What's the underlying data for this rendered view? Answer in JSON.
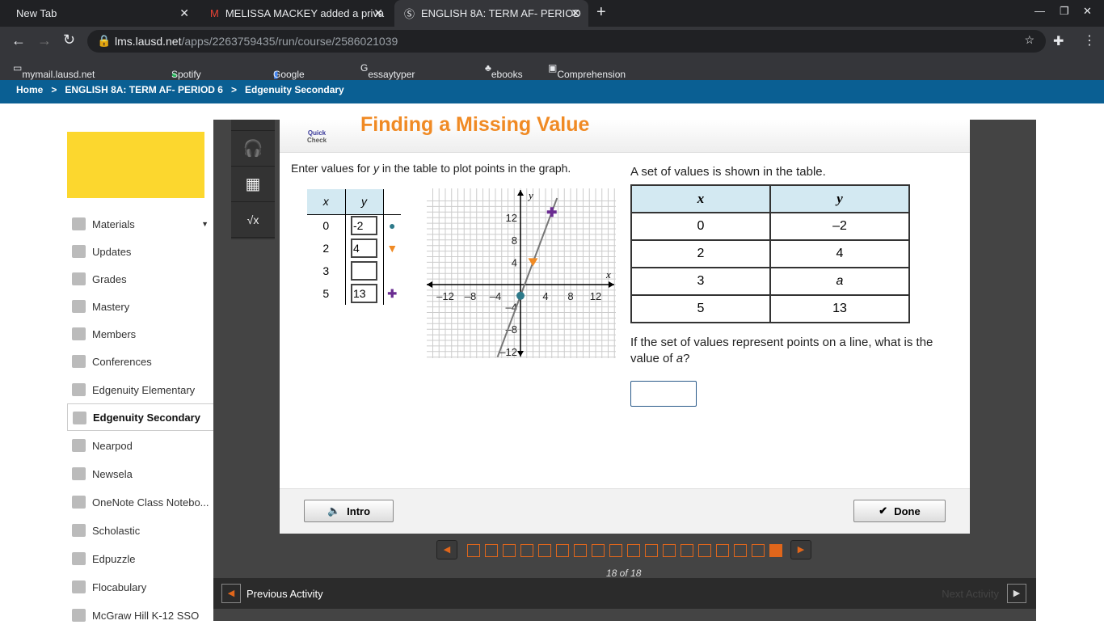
{
  "browser": {
    "tabs": [
      {
        "title": "New Tab"
      },
      {
        "title": "MELISSA MACKEY added a priva"
      },
      {
        "title": "ENGLISH 8A: TERM AF- PERIOD"
      }
    ],
    "url_host": "lms.lausd.net",
    "url_path": "/apps/2263759435/run/course/2586021039",
    "bookmarks": [
      "mymail.lausd.net bookmarks",
      "Spotify – Home",
      "Google Docs",
      "essaytyper - Google...",
      "ebooks",
      "Comprehension Qu..."
    ]
  },
  "breadcrumb": [
    "Home",
    ">",
    "ENGLISH 8A: TERM AF- PERIOD 6",
    ">",
    "Edgenuity Secondary"
  ],
  "sidebar": {
    "items": [
      "Materials",
      "Updates",
      "Grades",
      "Mastery",
      "Members",
      "Conferences",
      "Edgenuity Elementary",
      "Edgenuity Secondary",
      "Nearpod",
      "Newsela",
      "OneNote Class Notebo...",
      "Scholastic",
      "Edpuzzle",
      "Flocabulary",
      "McGraw Hill K-12 SSO"
    ],
    "active": "Edgenuity Secondary"
  },
  "activity": {
    "badge_line1": "Quick",
    "badge_line2": "Check",
    "title": "Finding a Missing Value",
    "instruction_pre": "Enter values for ",
    "instruction_var": "y",
    "instruction_post": " in the table to plot points in the graph.",
    "input_table": {
      "headers": [
        "x",
        "y"
      ],
      "rows": [
        {
          "x": "0",
          "y": "-2"
        },
        {
          "x": "2",
          "y": "4"
        },
        {
          "x": "3",
          "y": ""
        },
        {
          "x": "5",
          "y": "13"
        }
      ]
    },
    "prompt": "A set of values is shown in the table.",
    "table": {
      "headers": [
        "x",
        "y"
      ],
      "rows": [
        [
          "0",
          "–2"
        ],
        [
          "2",
          "4"
        ],
        [
          "3",
          "a"
        ],
        [
          "5",
          "13"
        ]
      ]
    },
    "question_pre": "If the set of values represent points on a line, what is the value of ",
    "question_var": "a",
    "question_post": "?",
    "answer": "",
    "intro_label": "Intro",
    "done_label": "Done"
  },
  "chart_data": {
    "type": "scatter",
    "xlabel": "x",
    "ylabel": "y",
    "xlim": [
      -15,
      15
    ],
    "ylim": [
      -15,
      15
    ],
    "xticks": [
      "–12",
      "–8",
      "–4",
      "4",
      "8",
      "12"
    ],
    "yticks": [
      "12",
      "8",
      "4",
      "–4",
      "–8",
      "–12"
    ],
    "points": [
      {
        "x": 0,
        "y": -2,
        "marker": "circle",
        "color": "#2e7a8a"
      },
      {
        "x": 2,
        "y": 4,
        "marker": "triangle",
        "color": "#f08a24"
      },
      {
        "x": 5,
        "y": 13,
        "marker": "plus",
        "color": "#6a2c91"
      }
    ],
    "line": {
      "slope": 3,
      "intercept": -2
    }
  },
  "pager": {
    "total": 18,
    "current": 18,
    "label": "18 of 18"
  },
  "bottom": {
    "prev": "Previous Activity",
    "next": "Next Activity"
  }
}
